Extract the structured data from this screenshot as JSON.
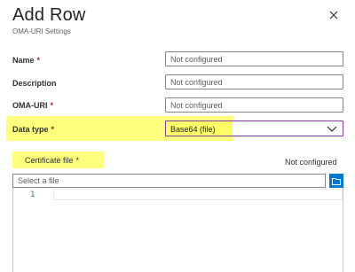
{
  "header": {
    "title": "Add Row",
    "subtitle": "OMA-URI Settings"
  },
  "form": {
    "name": {
      "label": "Name",
      "required": "*",
      "placeholder": "Not configured"
    },
    "description": {
      "label": "Description",
      "placeholder": "Not configured"
    },
    "oma_uri": {
      "label": "OMA-URI",
      "required": "*",
      "placeholder": "Not configured"
    },
    "data_type": {
      "label": "Data type",
      "required": "*",
      "selected": "Base64 (file)"
    },
    "certificate": {
      "label": "Certificate file",
      "required": "*",
      "status": "Not configured",
      "file_placeholder": "Select a file"
    }
  },
  "editor": {
    "line_number": "1"
  },
  "colors": {
    "highlight": "#ffff66",
    "accent": "#0078d4",
    "required": "#a4262c"
  }
}
